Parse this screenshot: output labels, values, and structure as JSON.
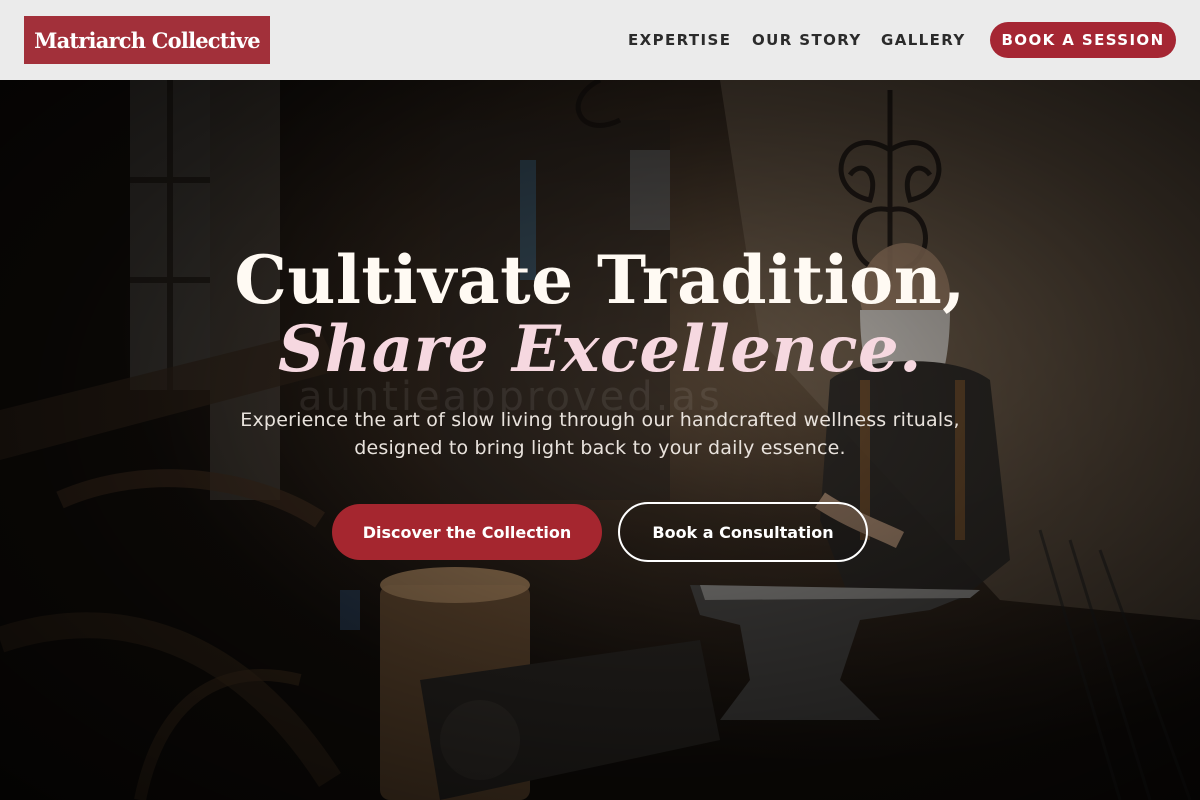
{
  "brand": {
    "name": "Matriarch Collective"
  },
  "nav": {
    "items": [
      {
        "label": "EXPERTISE"
      },
      {
        "label": "OUR STORY"
      },
      {
        "label": "GALLERY"
      }
    ],
    "cta_label": "BOOK A SESSION"
  },
  "hero": {
    "title_line1": "Cultivate Tradition,",
    "title_line2": "Share Excellence.",
    "watermark": "auntieapproved.as",
    "subtitle": "Experience the art of slow living through our handcrafted wellness rituals, designed to bring light back to your daily essence.",
    "primary_button": "Discover the Collection",
    "secondary_button": "Book a Consultation",
    "background_image": "blacksmith-workshop-photo"
  },
  "colors": {
    "brand": "#a2303a",
    "cta": "#a52633",
    "accent_pink": "#f6d8e0",
    "header_bg": "#ebebeb"
  }
}
